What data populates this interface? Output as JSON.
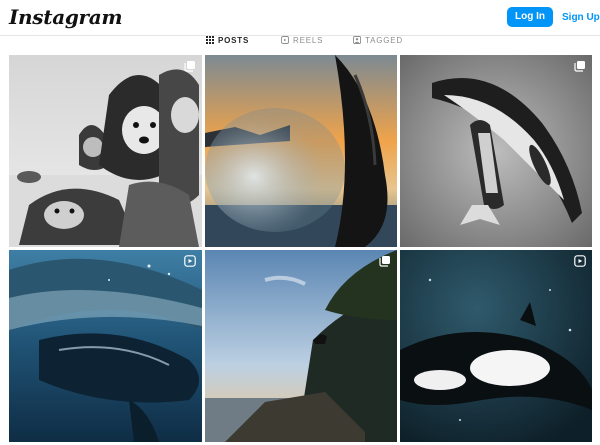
{
  "header": {
    "logo_text": "Instagram",
    "login_label": "Log In",
    "signup_label": "Sign Up"
  },
  "profile_tabs": [
    {
      "label": "POSTS",
      "icon": "grid-icon",
      "active": true
    },
    {
      "label": "REELS",
      "icon": "reels-icon",
      "active": false
    },
    {
      "label": "TAGGED",
      "icon": "tagged-icon",
      "active": false
    }
  ],
  "posts": [
    {
      "subject": "husky dogs",
      "badge": "carousel-icon",
      "tone": "monochrome"
    },
    {
      "subject": "orca fin splash at sunset",
      "badge": null,
      "tone": "warm sunset"
    },
    {
      "subject": "humpback whale and calf",
      "badge": "carousel-icon",
      "tone": "monochrome"
    },
    {
      "subject": "humpback whale underwater",
      "badge": "reel-icon",
      "tone": "deep blue"
    },
    {
      "subject": "wolf on rocky coast",
      "badge": "carousel-icon",
      "tone": "dusk"
    },
    {
      "subject": "orca underwater",
      "badge": "reel-icon",
      "tone": "dark teal"
    }
  ],
  "colors": {
    "brand_blue": "#0095f6",
    "text_dark": "#262626",
    "text_muted": "#8e8e8e"
  }
}
